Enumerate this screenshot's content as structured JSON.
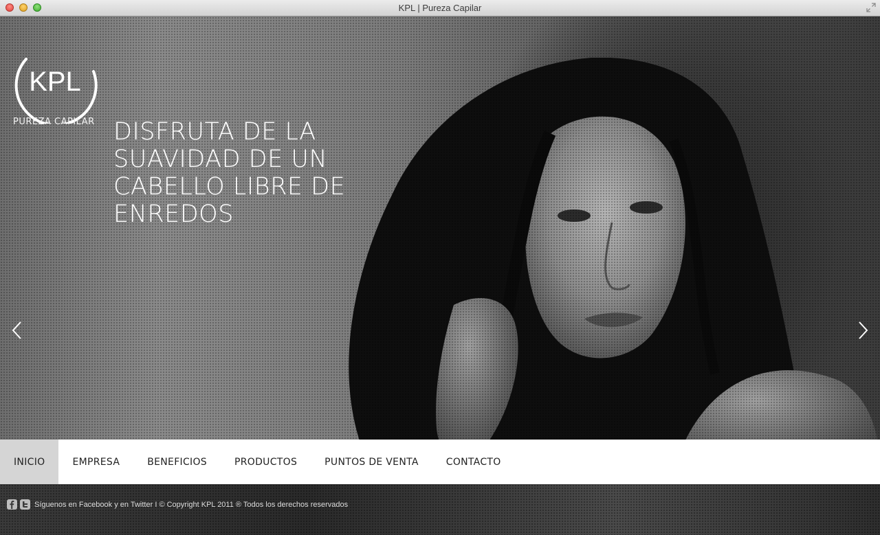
{
  "window": {
    "title": "KPL | Pureza Capilar"
  },
  "logo": {
    "mark": "KPL",
    "tagline": "PUREZA CAPILAR"
  },
  "hero": {
    "headline_lines": [
      "DISFRUTA DE LA",
      "SUAVIDAD DE UN",
      "CABELLO LIBRE DE",
      "ENREDOS"
    ]
  },
  "nav": {
    "items": [
      {
        "label": "INICIO",
        "active": true
      },
      {
        "label": "EMPRESA"
      },
      {
        "label": "BENEFICIOS"
      },
      {
        "label": "PRODUCTOS"
      },
      {
        "label": "PUNTOS DE VENTA"
      },
      {
        "label": "CONTACTO"
      }
    ]
  },
  "footer": {
    "follow_prefix": "Síguenos en",
    "facebook": "Facebook",
    "conj": "y en",
    "twitter": "Twitter",
    "copyright": "I © Copyright KPL 2011 ® Todos los derechos reservados"
  },
  "icons": {
    "facebook": "facebook-icon",
    "twitter": "twitter-icon",
    "prev": "chevron-left-icon",
    "next": "chevron-right-icon"
  }
}
